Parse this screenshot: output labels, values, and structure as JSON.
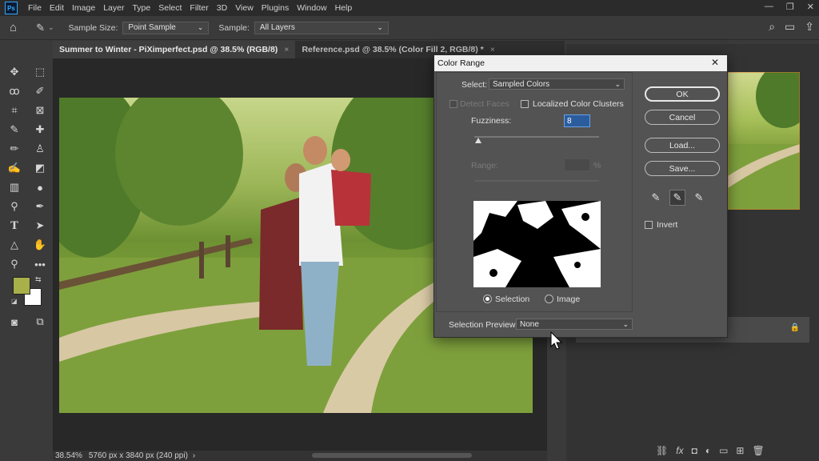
{
  "menubar": {
    "logo": "Ps",
    "items": [
      "File",
      "Edit",
      "Image",
      "Layer",
      "Type",
      "Select",
      "Filter",
      "3D",
      "View",
      "Plugins",
      "Window",
      "Help"
    ],
    "controls": [
      "—",
      "❐",
      "✕"
    ]
  },
  "options": {
    "sample_size_label": "Sample Size:",
    "sample_size_value": "Point Sample",
    "sample_label": "Sample:",
    "sample_value": "All Layers"
  },
  "tabs": [
    {
      "label": "Summer to Winter - PiXimperfect.psd @ 38.5% (RGB/8)",
      "close": "×"
    },
    {
      "label": "Reference.psd @ 38.5% (Color Fill 2, RGB/8) *",
      "close": "×"
    }
  ],
  "status": {
    "zoom": "38.54%",
    "info": "5760 px x 3840 px (240 ppi)",
    "arrow": "›"
  },
  "dialog": {
    "title": "Color Range",
    "close": "✕",
    "select_label": "Select:",
    "select_value": "Sampled Colors",
    "detect_faces": "Detect Faces",
    "localized_clusters": "Localized Color Clusters",
    "fuzziness_label": "Fuzziness:",
    "fuzziness_value": "8",
    "range_label": "Range:",
    "range_unit": "%",
    "selection_radio": "Selection",
    "image_radio": "Image",
    "preview_label": "Selection Preview:",
    "preview_value": "None",
    "ok": "OK",
    "cancel": "Cancel",
    "load": "Load...",
    "save": "Save...",
    "invert": "Invert",
    "fuzziness_fraction": 0.03
  },
  "colors": {
    "foreground": "#a8b04a",
    "background": "#ffffff",
    "accent": "#31a8ff"
  }
}
